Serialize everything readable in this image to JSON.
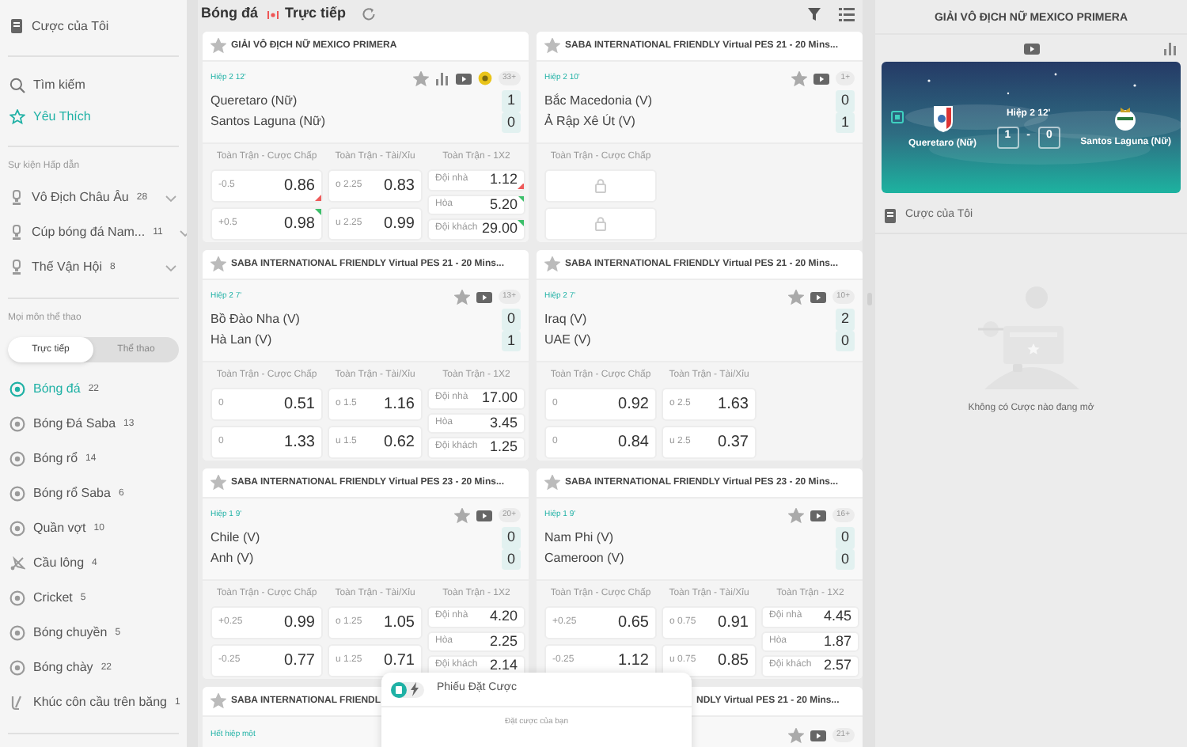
{
  "sidebar": {
    "my_bets": "Cược của Tôi",
    "search": "Tìm kiếm",
    "favorites": {
      "label": "Yêu Thích",
      "selected": true
    },
    "featured_heading": "Sự kiện Hấp dẫn",
    "featured": [
      {
        "label": "Vô Địch Châu Âu",
        "count": "28"
      },
      {
        "label": "Cúp bóng đá Nam...",
        "count": "11"
      },
      {
        "label": "Thế Vận Hội",
        "count": "8"
      }
    ],
    "sports_heading": "Mọi môn thể thao",
    "toggle": [
      {
        "label": "Trực tiếp",
        "selected": true
      },
      {
        "label": "Thể thao",
        "selected": false
      }
    ],
    "sports": [
      {
        "label": "Bóng đá",
        "count": "22",
        "kind": "ball",
        "selected": true
      },
      {
        "label": "Bóng Đá Saba",
        "count": "13",
        "kind": "ball",
        "selected": false
      },
      {
        "label": "Bóng rổ",
        "count": "14",
        "kind": "ball",
        "selected": false
      },
      {
        "label": "Bóng rổ Saba",
        "count": "6",
        "kind": "ball",
        "selected": false
      },
      {
        "label": "Quần vợt",
        "count": "10",
        "kind": "ball",
        "selected": false
      },
      {
        "label": "Cầu lông",
        "count": "4",
        "kind": "shuttlecock",
        "selected": false
      },
      {
        "label": "Cricket",
        "count": "5",
        "kind": "ball",
        "selected": false
      },
      {
        "label": "Bóng chuyền",
        "count": "5",
        "kind": "ball",
        "selected": false
      },
      {
        "label": "Bóng chày",
        "count": "22",
        "kind": "ball",
        "selected": false
      },
      {
        "label": "Khúc côn cầu trên băng",
        "count": "1",
        "kind": "stick",
        "selected": false
      }
    ]
  },
  "header": {
    "sport": "Bóng đá",
    "live": "Trực tiếp"
  },
  "matches": [
    {
      "league": "GIẢI VÔ ĐỊCH NỮ MEXICO PRIMERA",
      "period": "Hiệp 2 12'",
      "stats": true,
      "tracker": true,
      "more": "33+",
      "teams": [
        {
          "name": "Queretaro (Nữ)",
          "score": "1"
        },
        {
          "name": "Santos Laguna (Nữ)",
          "score": "0"
        }
      ],
      "markets": [
        {
          "title": "Toàn Trận - Cược Chấp",
          "kind": "line",
          "rows": [
            {
              "line": "-0.5",
              "odds": "0.86",
              "rising": false
            },
            {
              "line": "+0.5",
              "odds": "0.98",
              "rising": true
            }
          ]
        },
        {
          "title": "Toàn Trận - Tài/Xỉu",
          "kind": "line",
          "rows": [
            {
              "line": "o 2.25",
              "odds": "0.83"
            },
            {
              "line": "u 2.25",
              "odds": "0.99"
            }
          ]
        },
        {
          "title": "Toàn Trận - 1X2",
          "kind": "outcomes",
          "rows": [
            {
              "line": "Đội nhà",
              "odds": "1.12",
              "rising": false
            },
            {
              "line": "Hòa",
              "odds": "5.20",
              "rising": true
            },
            {
              "line": "Đội khách",
              "odds": "29.00",
              "rising": true
            }
          ]
        }
      ]
    },
    {
      "league": "SABA INTERNATIONAL FRIENDLY Virtual PES 21 - 20 Mins...",
      "period": "Hiệp 2 10'",
      "more": "1+",
      "teams": [
        {
          "name": "Bắc Macedonia (V)",
          "score": "0"
        },
        {
          "name": "Ả Rập Xê Út (V)",
          "score": "1"
        }
      ],
      "markets": [
        {
          "title": "Toàn Trận - Cược Chấp",
          "kind": "locked",
          "rows": [
            {
              "locked": true
            },
            {
              "locked": true
            }
          ]
        }
      ]
    },
    {
      "league": "SABA INTERNATIONAL FRIENDLY Virtual PES 21 - 20 Mins...",
      "period": "Hiệp 2 7'",
      "more": "13+",
      "teams": [
        {
          "name": "Bồ Đào Nha (V)",
          "score": "0"
        },
        {
          "name": "Hà Lan (V)",
          "score": "1"
        }
      ],
      "markets": [
        {
          "title": "Toàn Trận - Cược Chấp",
          "kind": "line",
          "rows": [
            {
              "line": "0",
              "odds": "0.51"
            },
            {
              "line": "0",
              "odds": "1.33"
            }
          ]
        },
        {
          "title": "Toàn Trận - Tài/Xỉu",
          "kind": "line",
          "rows": [
            {
              "line": "o 1.5",
              "odds": "1.16"
            },
            {
              "line": "u 1.5",
              "odds": "0.62"
            }
          ]
        },
        {
          "title": "Toàn Trận - 1X2",
          "kind": "outcomes",
          "rows": [
            {
              "line": "Đội nhà",
              "odds": "17.00"
            },
            {
              "line": "Hòa",
              "odds": "3.45"
            },
            {
              "line": "Đội khách",
              "odds": "1.25"
            }
          ]
        }
      ]
    },
    {
      "league": "SABA INTERNATIONAL FRIENDLY Virtual PES 21 - 20 Mins...",
      "period": "Hiệp 2 7'",
      "more": "10+",
      "teams": [
        {
          "name": "Iraq (V)",
          "score": "2"
        },
        {
          "name": "UAE (V)",
          "score": "0"
        }
      ],
      "markets": [
        {
          "title": "Toàn Trận - Cược Chấp",
          "kind": "line",
          "rows": [
            {
              "line": "0",
              "odds": "0.92"
            },
            {
              "line": "0",
              "odds": "0.84"
            }
          ]
        },
        {
          "title": "Toàn Trận - Tài/Xỉu",
          "kind": "line",
          "rows": [
            {
              "line": "o 2.5",
              "odds": "1.63"
            },
            {
              "line": "u 2.5",
              "odds": "0.37"
            }
          ]
        }
      ]
    },
    {
      "league": "SABA INTERNATIONAL FRIENDLY Virtual PES 23 - 20 Mins...",
      "period": "Hiệp 1 9'",
      "more": "20+",
      "teams": [
        {
          "name": "Chile (V)",
          "score": "0"
        },
        {
          "name": "Anh (V)",
          "score": "0"
        }
      ],
      "markets": [
        {
          "title": "Toàn Trận - Cược Chấp",
          "kind": "line",
          "rows": [
            {
              "line": "+0.25",
              "odds": "0.99"
            },
            {
              "line": "-0.25",
              "odds": "0.77"
            }
          ]
        },
        {
          "title": "Toàn Trận - Tài/Xỉu",
          "kind": "line",
          "rows": [
            {
              "line": "o 1.25",
              "odds": "1.05"
            },
            {
              "line": "u 1.25",
              "odds": "0.71"
            }
          ]
        },
        {
          "title": "Toàn Trận - 1X2",
          "kind": "outcomes",
          "rows": [
            {
              "line": "Đội nhà",
              "odds": "4.20"
            },
            {
              "line": "Hòa",
              "odds": "2.25"
            },
            {
              "line": "Đội khách",
              "odds": "2.14"
            }
          ]
        }
      ]
    },
    {
      "league": "SABA INTERNATIONAL FRIENDLY Virtual PES 23 - 20 Mins...",
      "period": "Hiệp 1 9'",
      "more": "16+",
      "teams": [
        {
          "name": "Nam Phi (V)",
          "score": "0"
        },
        {
          "name": "Cameroon (V)",
          "score": "0"
        }
      ],
      "markets": [
        {
          "title": "Toàn Trận - Cược Chấp",
          "kind": "line",
          "rows": [
            {
              "line": "+0.25",
              "odds": "0.65"
            },
            {
              "line": "-0.25",
              "odds": "1.12"
            }
          ]
        },
        {
          "title": "Toàn Trận - Tài/Xỉu",
          "kind": "line",
          "rows": [
            {
              "line": "o 0.75",
              "odds": "0.91"
            },
            {
              "line": "u 0.75",
              "odds": "0.85"
            }
          ]
        },
        {
          "title": "Toàn Trận - 1X2",
          "kind": "outcomes",
          "rows": [
            {
              "line": "Đội nhà",
              "odds": "4.45"
            },
            {
              "line": "Hòa",
              "odds": "1.87"
            },
            {
              "line": "Đội khách",
              "odds": "2.57"
            }
          ]
        }
      ]
    },
    {
      "league": "SABA INTERNATIONAL FRIENDL",
      "period": "Hết hiệp một",
      "kind": "head"
    },
    {
      "league": "NDLY Virtual PES 21 - 20 Mins...",
      "more": "21+",
      "kind": "tail"
    }
  ],
  "bet_slip": {
    "title": "Phiếu Đặt Cược",
    "hint": "Đặt cược của bạn"
  },
  "detail": {
    "league": "GIẢI VÔ ĐỊCH NỮ MEXICO PRIMERA",
    "period": "Hiệp 2 12'",
    "home": {
      "name": "Queretaro (Nữ)",
      "score": "1"
    },
    "away": {
      "name": "Santos Laguna (Nữ)",
      "score": "0"
    },
    "separator": "-",
    "my_bets": "Cược của Tôi",
    "empty": "Không có Cược nào đang mở"
  }
}
